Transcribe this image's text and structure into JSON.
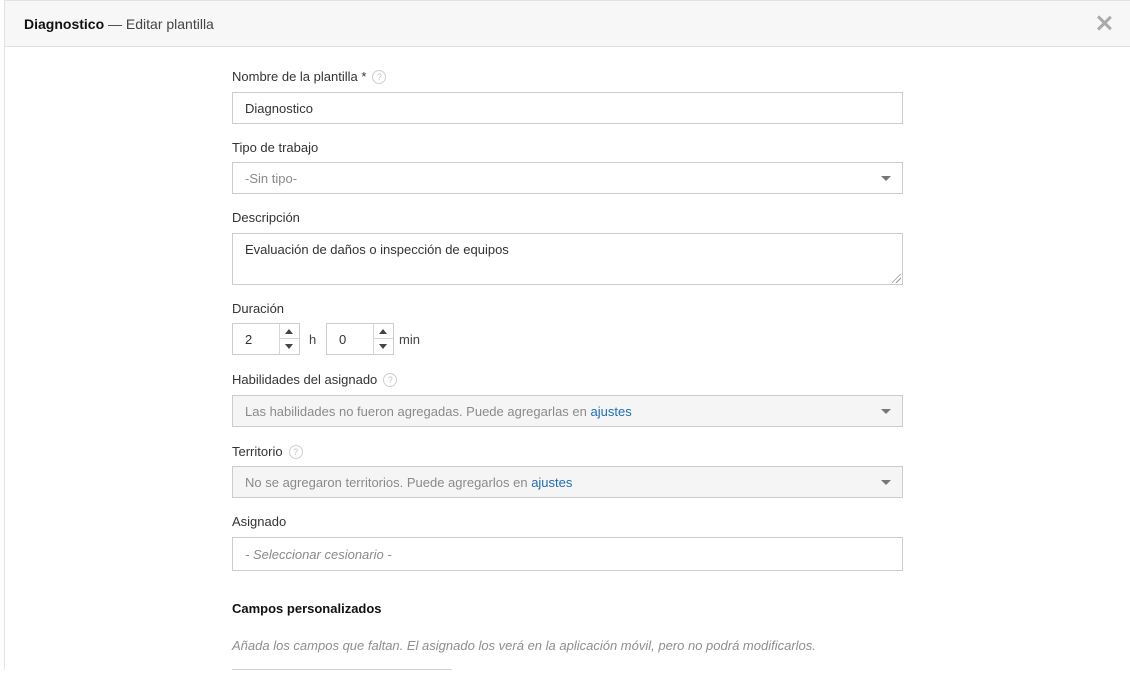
{
  "header": {
    "title": "Diagnostico",
    "subtitle": "— Editar plantilla",
    "close_icon": "close-icon"
  },
  "form": {
    "name": {
      "label": "Nombre de la plantilla *",
      "value": "Diagnostico",
      "help": "?"
    },
    "job_type": {
      "label": "Tipo de trabajo",
      "value": "-Sin tipo-"
    },
    "description": {
      "label": "Descripción",
      "value": "Evaluación de daños o inspección de equipos"
    },
    "duration": {
      "label": "Duración",
      "hours": "2",
      "hours_unit": "h",
      "minutes": "0",
      "minutes_unit": "min"
    },
    "skills": {
      "label": "Habilidades del asignado",
      "help": "?",
      "text": "Las habilidades no fueron agregadas. Puede agregarlas en",
      "link": "ajustes"
    },
    "territory": {
      "label": "Territorio",
      "help": "?",
      "text": "No se agregaron territorios. Puede agregarlos en",
      "link": "ajustes"
    },
    "assignee": {
      "label": "Asignado",
      "placeholder": "- Seleccionar cesionario -"
    }
  },
  "custom_fields": {
    "title": "Campos personalizados",
    "note": "Añada los campos que faltan. El asignado los verá en la aplicación móvil, pero no podrá modificarlos."
  },
  "colors": {
    "link": "#1e6db5",
    "border": "#cccccc",
    "header_bg": "#f7f7f7"
  }
}
